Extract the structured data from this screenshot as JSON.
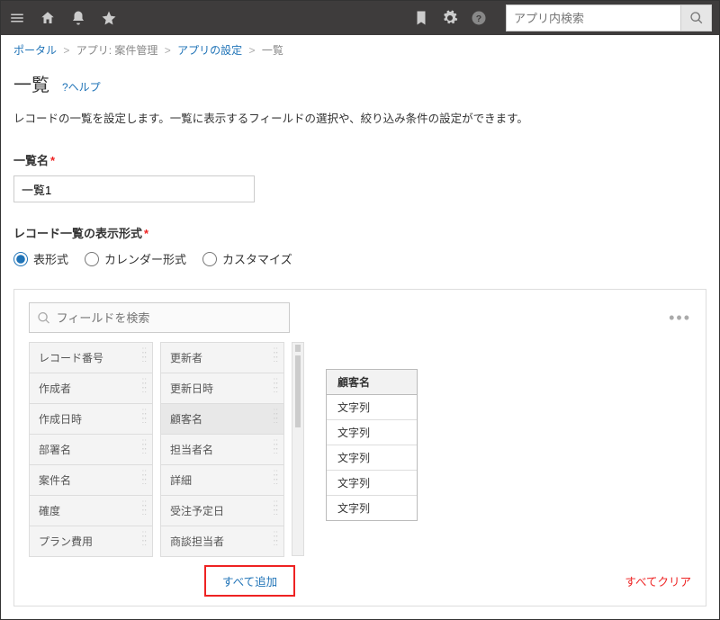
{
  "topbar": {
    "search_placeholder": "アプリ内検索"
  },
  "breadcrumb": {
    "portal": "ポータル",
    "app": "アプリ: 案件管理",
    "settings": "アプリの設定",
    "current": "一覧"
  },
  "page": {
    "title": "一覧",
    "help": "?ヘルプ",
    "description": "レコードの一覧を設定します。一覧に表示するフィールドの選択や、絞り込み条件の設定ができます。"
  },
  "form": {
    "name_label": "一覧名",
    "name_value": "一覧1",
    "display_label": "レコード一覧の表示形式",
    "radios": {
      "table": "表形式",
      "calendar": "カレンダー形式",
      "custom": "カスタマイズ"
    }
  },
  "picker": {
    "search_placeholder": "フィールドを検索",
    "col1": [
      "レコード番号",
      "作成者",
      "作成日時",
      "部署名",
      "案件名",
      "確度",
      "プラン費用"
    ],
    "col2": [
      "更新者",
      "更新日時",
      "顧客名",
      "担当者名",
      "詳細",
      "受注予定日",
      "商談担当者"
    ],
    "highlight": "顧客名",
    "preview_header": "顧客名",
    "preview_rows": [
      "文字列",
      "文字列",
      "文字列",
      "文字列",
      "文字列"
    ],
    "add_all": "すべて追加",
    "clear_all": "すべてクリア"
  }
}
